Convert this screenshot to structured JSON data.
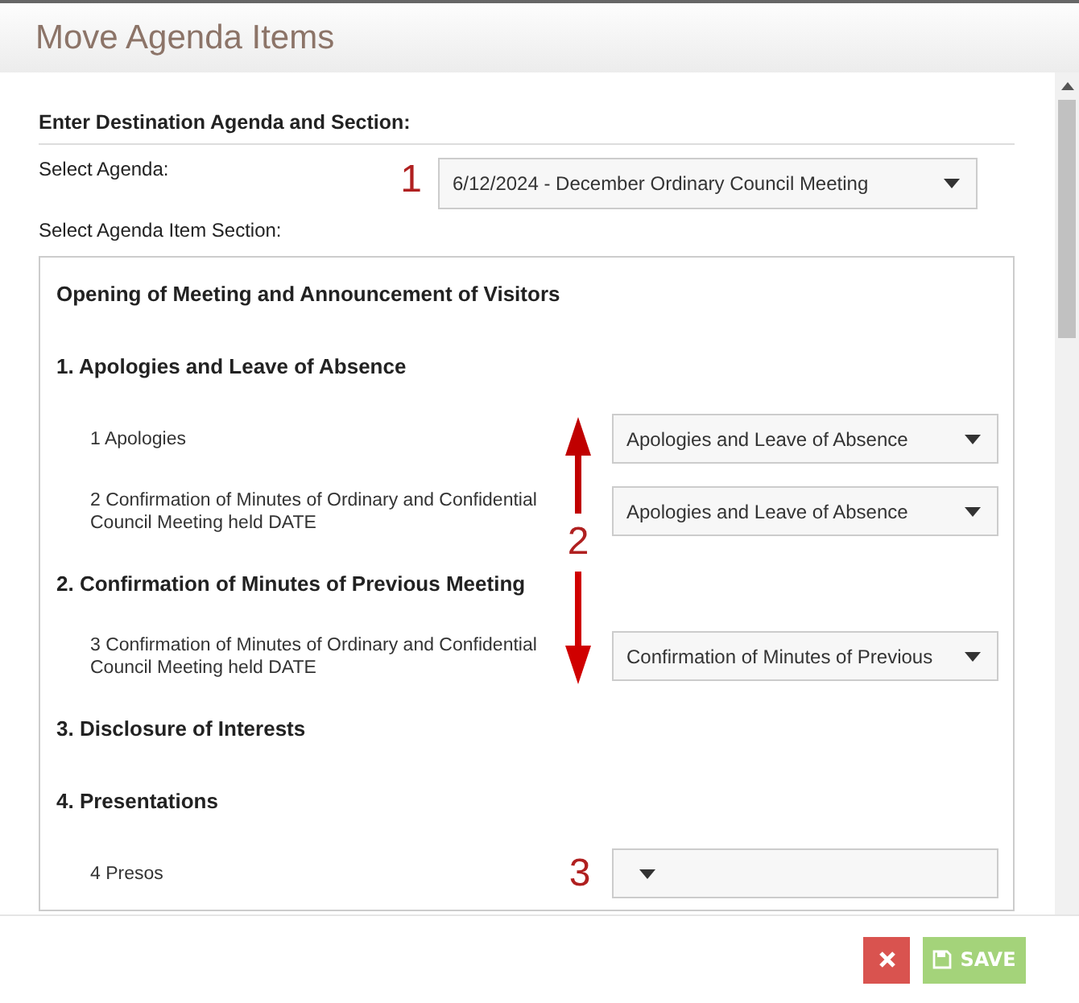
{
  "dialog": {
    "title": "Move Agenda Items"
  },
  "form": {
    "heading": "Enter Destination Agenda and Section:",
    "agenda_label": "Select Agenda:",
    "agenda_marker": "1",
    "agenda_value": "6/12/2024 - December Ordinary Council Meeting",
    "section_label": "Select Agenda Item Section:"
  },
  "sections": [
    {
      "title": "Opening of Meeting and Announcement of Visitors"
    },
    {
      "title": "1. Apologies and Leave of Absence",
      "items": [
        {
          "label": "1 Apologies",
          "value": "Apologies and Leave of Absence"
        },
        {
          "label": "2 Confirmation of Minutes of Ordinary and Confidential Council Meeting held DATE",
          "value": "Apologies and Leave of Absence"
        }
      ]
    },
    {
      "title": "2. Confirmation of Minutes of Previous Meeting",
      "items": [
        {
          "label": "3 Confirmation of Minutes of Ordinary and Confidential Council Meeting held DATE",
          "value": "Confirmation of Minutes of Previous"
        }
      ]
    },
    {
      "title": "3. Disclosure of Interests"
    },
    {
      "title": "4. Presentations",
      "items": [
        {
          "label": "4 Presos",
          "marker": "3"
        }
      ]
    }
  ],
  "annotations": [
    {
      "kind": "arrow-up"
    },
    {
      "kind": "number",
      "text": "2"
    },
    {
      "kind": "arrow-down"
    }
  ],
  "footer": {
    "save_label": "SAVE"
  }
}
